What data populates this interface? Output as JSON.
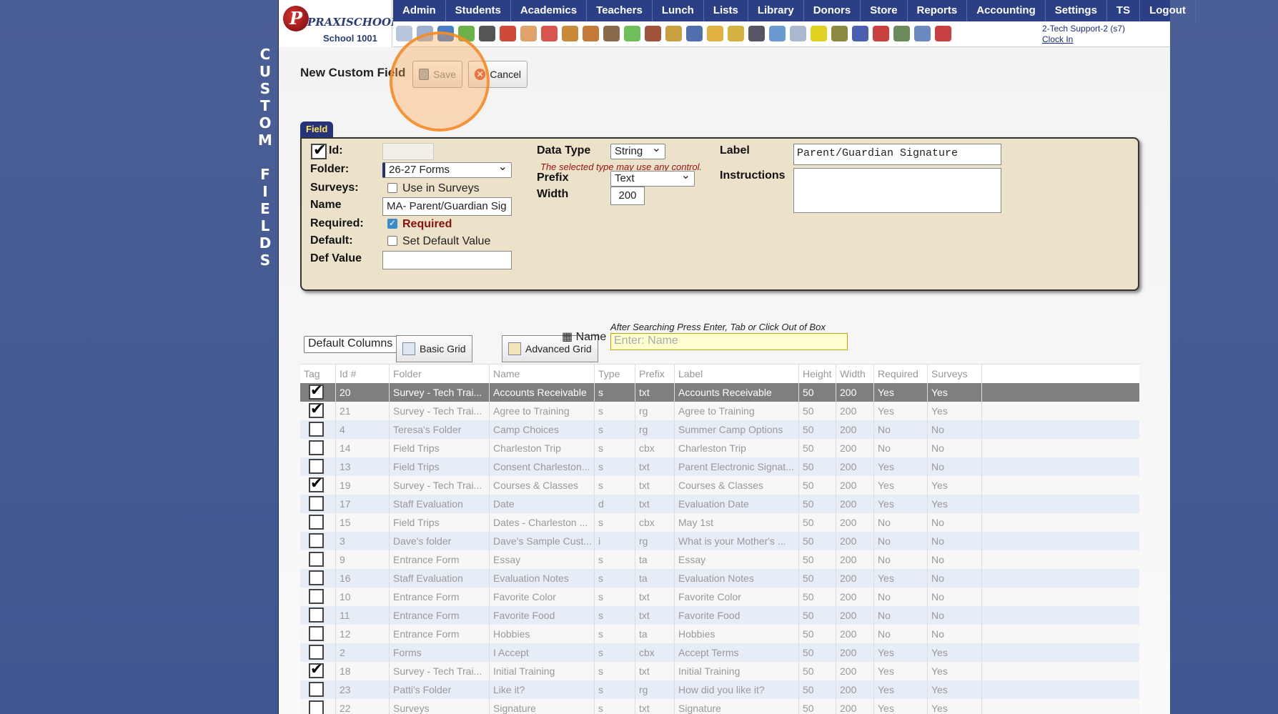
{
  "side_title": [
    "C",
    "U",
    "S",
    "T",
    "O",
    "M",
    "",
    "F",
    "I",
    "E",
    "L",
    "D",
    "S"
  ],
  "logo": {
    "letter": "P",
    "name": "PRAXISCHOOL",
    "school": "School 1001"
  },
  "nav": [
    "Admin",
    "Students",
    "Academics",
    "Teachers",
    "Lunch",
    "Lists",
    "Library",
    "Donors",
    "Store",
    "Reports",
    "Accounting",
    "Settings",
    "TS",
    "Logout"
  ],
  "toolbar_icons": [
    "search-icon",
    "calendar-icon",
    "globe-icon",
    "bus-icon",
    "phone-icon",
    "speaker-icon",
    "grid-icon",
    "calendar2-icon",
    "megaphone-icon",
    "student-icon",
    "teacher-icon",
    "pencil-icon",
    "users-icon",
    "bread-icon",
    "book-icon",
    "bell-icon",
    "export-icon",
    "person-icon",
    "clock-icon",
    "doc-icon",
    "card-icon",
    "printer-icon",
    "ap-icon",
    "pdf-icon",
    "money-icon",
    "help-icon",
    "power-icon"
  ],
  "user": {
    "name": "2-Tech Support-2 (s7)",
    "clock": "Clock In"
  },
  "page_title": "New Custom Field",
  "buttons": {
    "save": "Save",
    "cancel": "Cancel"
  },
  "tab": "Field",
  "form": {
    "id_label": "Id:",
    "id_value": "",
    "folder_label": "Folder:",
    "folder_value": "26-27 Forms",
    "surveys_label": "Surveys:",
    "surveys_option": "Use in Surveys",
    "name_label": "Name",
    "name_value": "MA- Parent/Guardian Sig",
    "required_label": "Required:",
    "required_option": "Required",
    "default_label": "Default:",
    "default_option": "Set Default Value",
    "defvalue_label": "Def Value",
    "defvalue_value": "",
    "datatype_label": "Data Type",
    "datatype_value": "String",
    "datatype_note": "The selected type may use any control.",
    "prefix_label": "Prefix",
    "prefix_value": "Text",
    "width_label": "Width",
    "width_value": "200",
    "label_label": "Label",
    "label_value": "Parent/Guardian Signature",
    "instructions_label": "Instructions",
    "instructions_value": ""
  },
  "grid_toolbar": {
    "columns": "Default Columns",
    "basic": "Basic Grid",
    "advanced": "Advanced Grid",
    "name_label": "Name",
    "hint": "After Searching Press Enter, Tab or Click Out of Box",
    "search_placeholder": "Enter: Name"
  },
  "columns": [
    "Tag",
    "Id #",
    "Folder",
    "Name",
    "Type",
    "Prefix",
    "Label",
    "Height",
    "Width",
    "Required",
    "Surveys"
  ],
  "rows": [
    {
      "tag": true,
      "id": "20",
      "folder": "Survey - Tech Trai...",
      "name": "Accounts Receivable",
      "type": "s",
      "prefix": "txt",
      "label": "Accounts Receivable",
      "height": "50",
      "width": "200",
      "required": "Yes",
      "surveys": "Yes",
      "selected": true
    },
    {
      "tag": true,
      "id": "21",
      "folder": "Survey - Tech Trai...",
      "name": "Agree to Training",
      "type": "s",
      "prefix": "rg",
      "label": "Agree to Training",
      "height": "50",
      "width": "200",
      "required": "Yes",
      "surveys": "Yes"
    },
    {
      "tag": false,
      "id": "4",
      "folder": "Teresa's Folder",
      "name": "Camp Choices",
      "type": "s",
      "prefix": "rg",
      "label": "Summer Camp Options",
      "height": "50",
      "width": "200",
      "required": "No",
      "surveys": "No"
    },
    {
      "tag": false,
      "id": "14",
      "folder": "Field Trips",
      "name": "Charleston Trip",
      "type": "s",
      "prefix": "cbx",
      "label": "Charleston Trip",
      "height": "50",
      "width": "200",
      "required": "No",
      "surveys": "No"
    },
    {
      "tag": false,
      "id": "13",
      "folder": "Field Trips",
      "name": "Consent Charleston...",
      "type": "s",
      "prefix": "txt",
      "label": "Parent Electronic Signat...",
      "height": "50",
      "width": "200",
      "required": "Yes",
      "surveys": "No"
    },
    {
      "tag": true,
      "id": "19",
      "folder": "Survey - Tech Trai...",
      "name": "Courses & Classes",
      "type": "s",
      "prefix": "txt",
      "label": "Courses & Classes",
      "height": "50",
      "width": "200",
      "required": "Yes",
      "surveys": "Yes"
    },
    {
      "tag": false,
      "id": "17",
      "folder": "Staff Evaluation",
      "name": "Date",
      "type": "d",
      "prefix": "txt",
      "label": "Evaluation Date",
      "height": "50",
      "width": "200",
      "required": "Yes",
      "surveys": "Yes"
    },
    {
      "tag": false,
      "id": "15",
      "folder": "Field Trips",
      "name": "Dates - Charleston ...",
      "type": "s",
      "prefix": "cbx",
      "label": "May 1st",
      "height": "50",
      "width": "200",
      "required": "No",
      "surveys": "No"
    },
    {
      "tag": false,
      "id": "3",
      "folder": "Dave's folder",
      "name": "Dave's Sample Cust...",
      "type": "i",
      "prefix": "rg",
      "label": "What is your Mother's ...",
      "height": "50",
      "width": "200",
      "required": "No",
      "surveys": "No"
    },
    {
      "tag": false,
      "id": "9",
      "folder": "Entrance Form",
      "name": "Essay",
      "type": "s",
      "prefix": "ta",
      "label": "Essay",
      "height": "50",
      "width": "200",
      "required": "No",
      "surveys": "No"
    },
    {
      "tag": false,
      "id": "16",
      "folder": "Staff Evaluation",
      "name": "Evaluation Notes",
      "type": "s",
      "prefix": "ta",
      "label": "Evaluation Notes",
      "height": "50",
      "width": "200",
      "required": "Yes",
      "surveys": "No"
    },
    {
      "tag": false,
      "id": "10",
      "folder": "Entrance Form",
      "name": "Favorite Color",
      "type": "s",
      "prefix": "txt",
      "label": "Favorite Color",
      "height": "50",
      "width": "200",
      "required": "No",
      "surveys": "No"
    },
    {
      "tag": false,
      "id": "11",
      "folder": "Entrance Form",
      "name": "Favorite Food",
      "type": "s",
      "prefix": "txt",
      "label": "Favorite Food",
      "height": "50",
      "width": "200",
      "required": "No",
      "surveys": "No"
    },
    {
      "tag": false,
      "id": "12",
      "folder": "Entrance Form",
      "name": "Hobbies",
      "type": "s",
      "prefix": "ta",
      "label": "Hobbies",
      "height": "50",
      "width": "200",
      "required": "No",
      "surveys": "No"
    },
    {
      "tag": false,
      "id": "2",
      "folder": "Forms",
      "name": "I Accept",
      "type": "s",
      "prefix": "cbx",
      "label": "Accept Terms",
      "height": "50",
      "width": "200",
      "required": "Yes",
      "surveys": "Yes"
    },
    {
      "tag": true,
      "id": "18",
      "folder": "Survey - Tech Trai...",
      "name": "Initial Training",
      "type": "s",
      "prefix": "txt",
      "label": "Initial Training",
      "height": "50",
      "width": "200",
      "required": "Yes",
      "surveys": "Yes"
    },
    {
      "tag": false,
      "id": "23",
      "folder": "Patti's Folder",
      "name": "Like it?",
      "type": "s",
      "prefix": "rg",
      "label": "How did you like it?",
      "height": "50",
      "width": "200",
      "required": "Yes",
      "surveys": "Yes"
    },
    {
      "tag": false,
      "id": "22",
      "folder": "Surveys",
      "name": "Signature",
      "type": "s",
      "prefix": "txt",
      "label": "Signature",
      "height": "50",
      "width": "200",
      "required": "Yes",
      "surveys": "Yes"
    }
  ]
}
